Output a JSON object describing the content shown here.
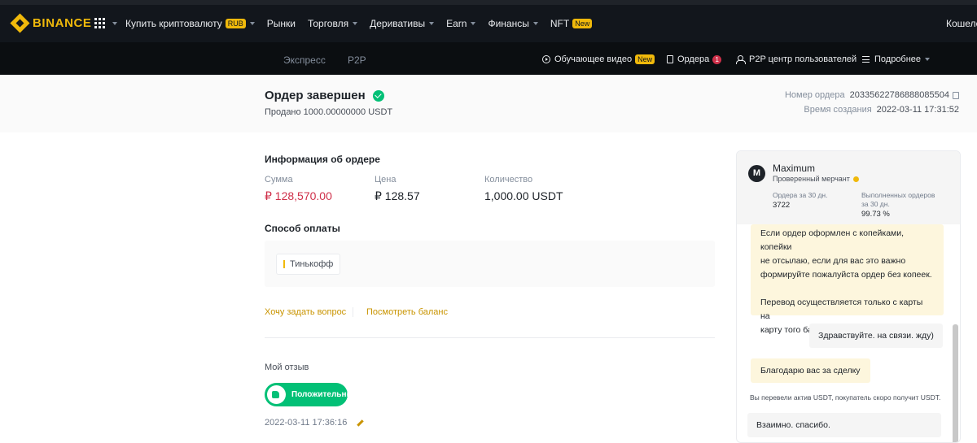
{
  "topnav": {
    "logo": "BINANCE",
    "items": [
      {
        "label": "Купить криптовалюту",
        "badge": "RUB",
        "caret": true
      },
      {
        "label": "Рынки",
        "badge": "",
        "caret": false
      },
      {
        "label": "Торговля",
        "badge": "",
        "caret": true
      },
      {
        "label": "Деривативы",
        "badge": "",
        "caret": true
      },
      {
        "label": "Earn",
        "badge": "",
        "caret": true
      },
      {
        "label": "Финансы",
        "badge": "",
        "caret": true
      },
      {
        "label": "NFT",
        "badge": "New",
        "caret": false
      }
    ],
    "wallet": "Кошеле"
  },
  "subnav": {
    "tabs": [
      "Экспресс",
      "P2P"
    ],
    "tutorial": "Обучающее видео",
    "tutorial_badge": "New",
    "orders": "Ордера",
    "orders_count": "1",
    "user_center": "P2P центр пользователей",
    "more": "Подробнее"
  },
  "order": {
    "title": "Ордер завершен",
    "subtitle": "Продано 1000.00000000 USDT",
    "number_label": "Номер ордера",
    "number": "20335622786888085504",
    "created_label": "Время создания",
    "created": "2022-03-11 17:31:52"
  },
  "info": {
    "title": "Информация об ордере",
    "amount_label": "Сумма",
    "amount": "₽ 128,570.00",
    "price_label": "Цена",
    "price": "₽ 128.57",
    "qty_label": "Количество",
    "qty": "1,000.00 USDT"
  },
  "payment": {
    "title": "Способ оплаты",
    "method": "Тинькофф"
  },
  "links": {
    "ask": "Хочу задать вопрос",
    "balance": "Посмотреть баланс"
  },
  "review": {
    "label": "Мой отзыв",
    "button": "Положительный",
    "date": "2022-03-11 17:36:16"
  },
  "chat": {
    "name": "Maximum",
    "avatar_letter": "M",
    "verified": "Проверенный мерчант",
    "orders30_label": "Ордера за 30 дн.",
    "orders30": "3722",
    "completed_label_1": "Выполненных ордеров",
    "completed_label_2": "за 30 дн.",
    "completed": "99.73 %",
    "msg1": [
      "Если ордер оформлен с копейками, копейки",
      "не отсылаю, если для вас это важно",
      "формируйте пожалуйста ордер без копеек."
    ],
    "msg2": [
      "Перевод осуществляется только с карты на",
      "карту того банка который указан в ордере."
    ],
    "reply1": "Здравствуйте. на связи. жду)",
    "thanks": "Благодарю вас за сделку",
    "system": "Вы перевели актив USDT, покупатель скоро получит USDT.",
    "reply2": "Взаимно. спасибо."
  }
}
